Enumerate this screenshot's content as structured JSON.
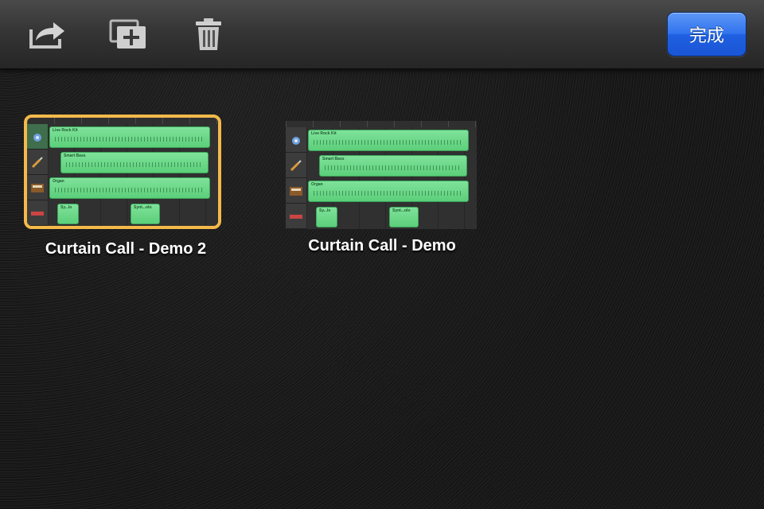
{
  "toolbar": {
    "share_icon": "share-icon",
    "new_icon": "new-song-icon",
    "trash_icon": "trash-icon",
    "done_label": "完成",
    "done_color": "#2a6ae8"
  },
  "songs": [
    {
      "title": "Curtain Call - Demo 2",
      "selected": true,
      "tracks": [
        "Live Rock Kit",
        "Smart Bass",
        "Organ",
        "Sy...lo",
        "Synt...olo"
      ]
    },
    {
      "title": "Curtain Call - Demo",
      "selected": false,
      "tracks": [
        "Live Rock Kit",
        "Smart Bass",
        "Organ",
        "Sy...lo",
        "Synt...olo"
      ]
    }
  ],
  "colors": {
    "selection": "#f4b94a",
    "region": "#6fd98b",
    "background": "#1b1b1b"
  }
}
